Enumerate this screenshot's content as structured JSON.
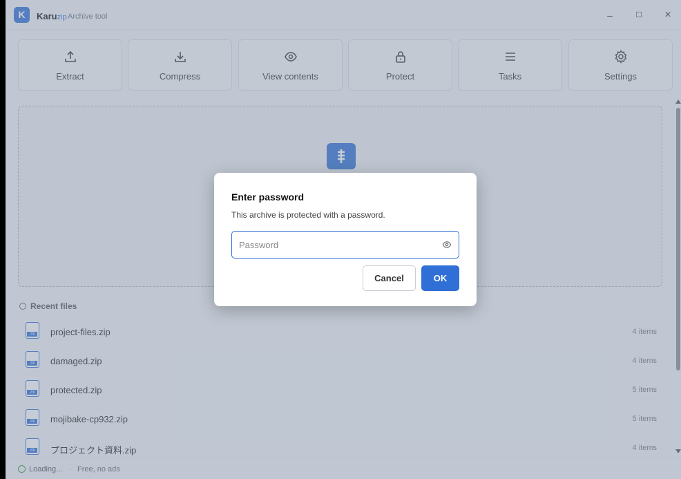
{
  "window": {
    "app_name": "Karu",
    "app_name_suffix": "zip",
    "subtitle": "Archive tool",
    "controls": {
      "minimize": "–",
      "maximize": "☐",
      "close": "×"
    }
  },
  "toolbar": {
    "items": [
      {
        "label": "Extract",
        "icon": "upload-icon"
      },
      {
        "label": "Compress",
        "icon": "download-icon"
      },
      {
        "label": "View contents",
        "icon": "eye-icon"
      },
      {
        "label": "Protect",
        "icon": "lock-icon"
      },
      {
        "label": "Tasks",
        "icon": "list-icon"
      },
      {
        "label": "Settings",
        "icon": "gear-icon"
      }
    ]
  },
  "recent": {
    "header": "Recent files",
    "files": [
      {
        "name": "project-files.zip",
        "count": "4 items"
      },
      {
        "name": "damaged.zip",
        "count": "4 items"
      },
      {
        "name": "protected.zip",
        "count": "5 items"
      },
      {
        "name": "mojibake-cp932.zip",
        "count": "5 items"
      },
      {
        "name": "プロジェクト資料.zip",
        "count": "4 items"
      }
    ],
    "file_tag": ".zip"
  },
  "status": {
    "text": "Loading...",
    "separator": "·",
    "extra": "Free, no ads"
  },
  "dialog": {
    "title": "Enter password",
    "description": "This archive is protected with a password.",
    "placeholder": "Password",
    "cancel_label": "Cancel",
    "ok_label": "OK"
  },
  "colors": {
    "accent": "#2f6fd6",
    "status_ok": "#2e9e4f"
  }
}
